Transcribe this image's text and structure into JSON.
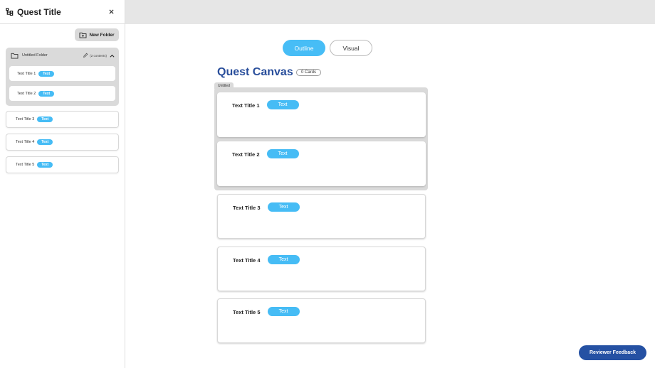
{
  "sidebar": {
    "title": "Quest Title",
    "new_folder_label": "New Folder",
    "folder": {
      "name": "Untitled Folder",
      "count": "(2 contents)",
      "items": [
        {
          "label": "Text Title 1",
          "badge": "Text"
        },
        {
          "label": "Text Title 2",
          "badge": "Text"
        }
      ]
    },
    "items": [
      {
        "label": "Text Title 3",
        "badge": "Text"
      },
      {
        "label": "Text Title 4",
        "badge": "Text"
      },
      {
        "label": "Text Title 5",
        "badge": "Text"
      }
    ]
  },
  "tabs": [
    {
      "label": "Outline",
      "active": true
    },
    {
      "label": "Visual",
      "active": false
    }
  ],
  "canvas": {
    "title": "Quest Canvas",
    "cards_count": "0 Cards",
    "group_label": "Untitled",
    "cards": [
      {
        "title": "Text Title 1",
        "badge": "Text"
      },
      {
        "title": "Text Title 2",
        "badge": "Text"
      },
      {
        "title": "Text Title 3",
        "badge": "Text"
      },
      {
        "title": "Text Title 4",
        "badge": "Text"
      },
      {
        "title": "Text Title 5",
        "badge": "Text"
      }
    ]
  },
  "feedback_label": "Reviewer Feedback",
  "colors": {
    "accent": "#46bcf5",
    "title": "#294e9b",
    "feedback": "#2551a3"
  }
}
